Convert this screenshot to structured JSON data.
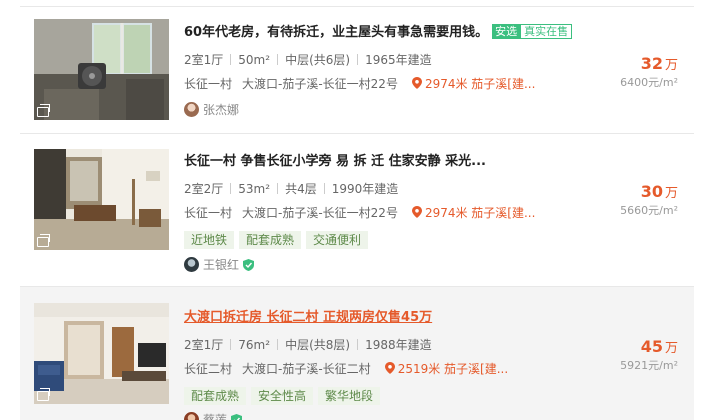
{
  "listings": [
    {
      "title": "60年代老房，有待拆迁，业主屋头有事急需要用钱。",
      "tag_an": "安选",
      "tag_real": "真实在售",
      "attrs": [
        "2室1厅",
        "50m²",
        "中层(共6层)",
        "1965年建造"
      ],
      "community": "长征一村",
      "address": "大渡口-茄子溪-长征一村22号",
      "distance": "2974米 茄子溪[建...",
      "tags": [],
      "agent": "张杰娜",
      "verified": false,
      "price": "32",
      "price_unit": "万",
      "unit_price": "6400元/m²",
      "highlight_title": false,
      "icons": [
        "album-icon",
        "location-pin-icon",
        "avatar"
      ]
    },
    {
      "title": "长征一村 争售长征小学旁 易 拆 迁 住家安静 采光...",
      "attrs": [
        "2室2厅",
        "53m²",
        "共4层",
        "1990年建造"
      ],
      "community": "长征一村",
      "address": "大渡口-茄子溪-长征一村22号",
      "distance": "2974米 茄子溪[建...",
      "tags": [
        "近地铁",
        "配套成熟",
        "交通便利"
      ],
      "agent": "王银红",
      "verified": true,
      "price": "30",
      "price_unit": "万",
      "unit_price": "5660元/m²",
      "highlight_title": false,
      "icons": [
        "album-icon",
        "location-pin-icon",
        "avatar",
        "verified-shield-icon"
      ]
    },
    {
      "title": "大渡口拆迁房 长征二村 正规两房仅售45万",
      "attrs": [
        "2室1厅",
        "76m²",
        "中层(共8层)",
        "1988年建造"
      ],
      "community": "长征二村",
      "address": "大渡口-茄子溪-长征二村",
      "distance": "2519米 茄子溪[建...",
      "tags": [
        "配套成熟",
        "安全性高",
        "繁华地段"
      ],
      "agent": "蔡莲",
      "verified": true,
      "price": "45",
      "price_unit": "万",
      "unit_price": "5921元/m²",
      "highlight_title": true,
      "icons": [
        "album-icon",
        "location-pin-icon",
        "avatar",
        "verified-shield-icon"
      ]
    }
  ],
  "colors": {
    "accent": "#e55a2b",
    "tag_green": "#3bbf7f",
    "chip_bg": "#eef4ea",
    "chip_text": "#5e8a4a",
    "muted": "#999999"
  }
}
